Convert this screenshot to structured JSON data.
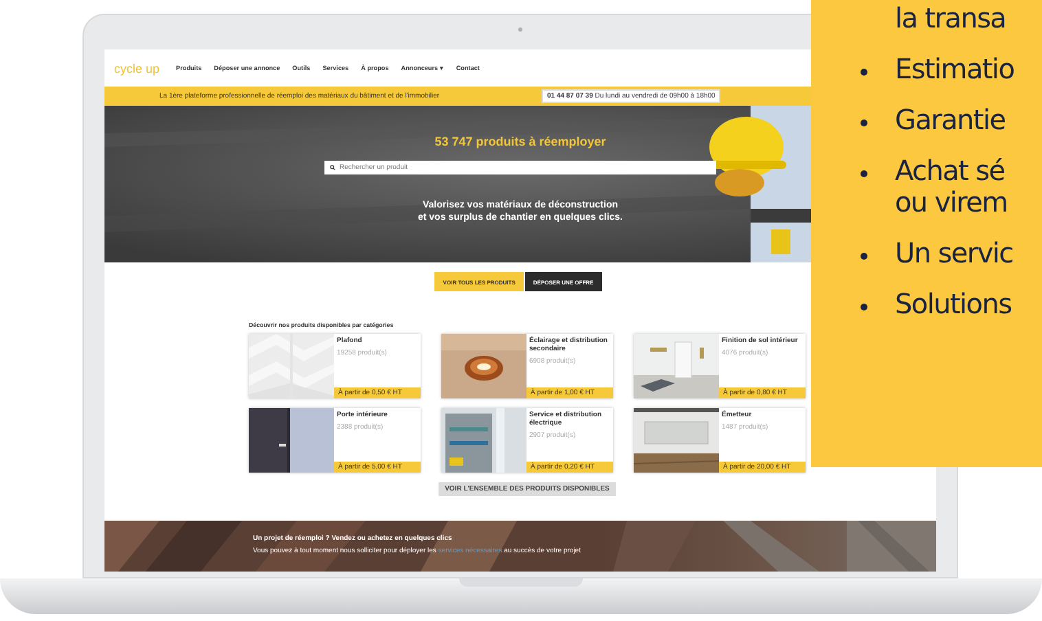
{
  "site": {
    "logo": "cycle up",
    "nav": [
      "Produits",
      "Déposer une annonce",
      "Outils",
      "Services",
      "À propos",
      "Annonceurs ▾",
      "Contact"
    ],
    "banner": {
      "text": "La 1ère plateforme professionnelle de réemploi des matériaux du bâtiment et de l'immobilier",
      "phone": "01 44 87 07 39",
      "phone_note": "Du lundi au vendredi de 09h00 à 18h00"
    },
    "hero": {
      "title": "53 747 produits à réemployer",
      "search_placeholder": "Rechercher un produit",
      "tagline": [
        "Valorisez vos matériaux de déconstruction",
        "et vos surplus de chantier en quelques clics."
      ]
    },
    "actions": [
      {
        "label": "VOIR TOUS LES PRODUITS",
        "kind": "primary"
      },
      {
        "label": "DÉPOSER UNE OFFRE",
        "kind": "dark"
      }
    ],
    "categories": {
      "heading": "Découvrir nos produits disponibles par catégories",
      "items": [
        {
          "name": "Plafond",
          "count": "19258 produit(s)",
          "price": "À partir de 0,50 € HT"
        },
        {
          "name": "Éclairage et distribution secondaire",
          "count": "6908 produit(s)",
          "price": "À partir de 1,00 € HT"
        },
        {
          "name": "Finition de sol intérieur",
          "count": "4076 produit(s)",
          "price": "À partir de 0,80 € HT"
        },
        {
          "name": "Porte intérieure",
          "count": "2388 produit(s)",
          "price": "À partir de 5,00 € HT"
        },
        {
          "name": "Service et distribution électrique",
          "count": "2907 produit(s)",
          "price": "À partir de 0,20 € HT"
        },
        {
          "name": "Émetteur",
          "count": "1487 produit(s)",
          "price": "À partir de 20,00 € HT"
        }
      ],
      "more": "VOIR L'ENSEMBLE DES PRODUITS DISPONIBLES"
    },
    "footer": {
      "title": "Un projet de réemploi ? Vendez ou achetez en quelques clics",
      "text_before": "Vous pouvez à tout moment nous solliciter pour déployer les",
      "link": "services nécessaires",
      "text_after": "au succès de votre projet"
    }
  },
  "overlay": [
    {
      "lines": [
        "la transa"
      ],
      "bullet": false
    },
    {
      "lines": [
        "Estimatio"
      ],
      "bullet": true
    },
    {
      "lines": [
        "Garantie"
      ],
      "bullet": true
    },
    {
      "lines": [
        "Achat sé",
        "ou virem"
      ],
      "bullet": true
    },
    {
      "lines": [
        "Un servic"
      ],
      "bullet": true
    },
    {
      "lines": [
        "Solutions"
      ],
      "bullet": true
    }
  ]
}
